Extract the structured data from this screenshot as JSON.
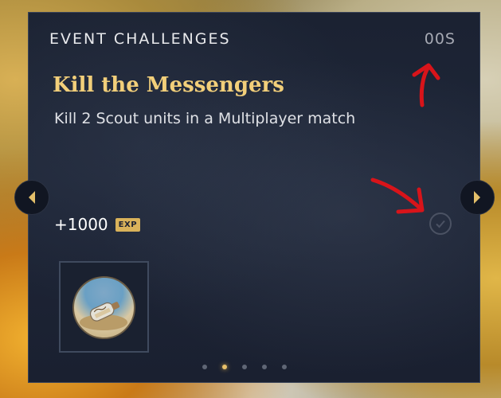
{
  "header": {
    "title": "EVENT CHALLENGES",
    "timer": "00S"
  },
  "challenge": {
    "title": "Kill the Messengers",
    "description": "Kill 2 Scout units in a Multiplayer match",
    "reward_amount": "+1000",
    "reward_type": "EXP",
    "completed": false
  },
  "pagination": {
    "total": 5,
    "active_index": 1
  },
  "colors": {
    "accent": "#f2cf7a",
    "panel": "#1e2638",
    "annotation": "#d8141a"
  },
  "icons": {
    "prev": "chevron-left-icon",
    "next": "chevron-right-icon",
    "complete": "checkmark-circle-icon",
    "reward": "message-in-bottle-icon"
  }
}
